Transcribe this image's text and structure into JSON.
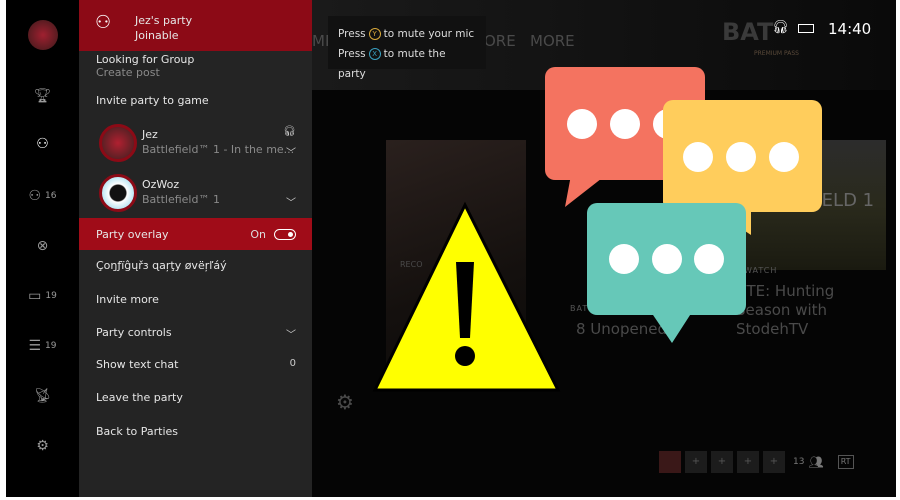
{
  "rail": {
    "items": [
      {
        "icon": "avatar"
      },
      {
        "icon": "trophy-icon"
      },
      {
        "icon": "party-icon"
      },
      {
        "icon": "friends-icon",
        "count": "16"
      },
      {
        "icon": "xbox-icon"
      },
      {
        "icon": "messages-icon",
        "count": "19"
      },
      {
        "icon": "notifications-icon",
        "count": "19"
      },
      {
        "icon": "broadcast-icon"
      },
      {
        "icon": "settings-icon"
      }
    ]
  },
  "party": {
    "title": "Jez's party",
    "status": "Joinable",
    "lfg": {
      "label": "Looking for Group",
      "sub": "Create post"
    },
    "invite_game": "Invite party to game",
    "members": [
      {
        "name": "Jez",
        "game": "Battlefield™ 1 - In the me..."
      },
      {
        "name": "OzWoz",
        "game": "Battlefield™ 1"
      }
    ],
    "overlay": {
      "label": "Party overlay",
      "state": "On"
    },
    "menu": [
      "Çοŋƒïĝųřɜ ɋaŗţy øvëŗľáý",
      "Invite more",
      "Party controls",
      "Show text chat",
      "Leave the party",
      "Back to Parties"
    ],
    "text_chat_count": "0"
  },
  "tooltip": {
    "line1_pre": "Press",
    "line1_btn": "Y",
    "line1_post": "to mute your mic",
    "line2_pre": "Press",
    "line2_btn": "X",
    "line2_post": "to mute the party"
  },
  "topbar": {
    "tabs": [
      "MP",
      "ORE",
      "MORE"
    ],
    "game_title": "BAT",
    "pass": "PREMIUM PASS",
    "time": "14:40"
  },
  "tiles": {
    "left_tag": "BAT",
    "left_title": "8 Unopened",
    "right_tag": "WATCH",
    "right_title": "CTE: Hunting Season with StodehTV",
    "big": "FIELD 1",
    "rec": "RECO"
  },
  "footer": {
    "count": "13",
    "badge": "RT"
  },
  "colors": {
    "accent": "#8c0a16",
    "warning": "#ffff00",
    "bubble_coral": "#f47360",
    "bubble_yellow": "#ffcd5c",
    "bubble_teal": "#66c8b8"
  }
}
